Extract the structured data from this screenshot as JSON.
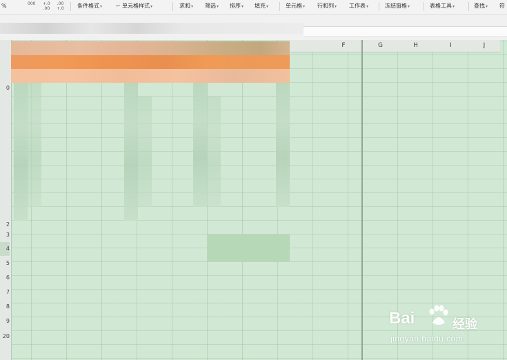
{
  "toolbar": {
    "percent": "%",
    "thousands": "000",
    "dec_inc_top": "+.0",
    "dec_inc_bottom": ".00",
    "dec_dec_top": ".00",
    "dec_dec_bottom": "+.0",
    "conditional_format": "条件格式",
    "cell_style": "单元格样式",
    "sum": "求和",
    "filter": "筛选",
    "sort": "排序",
    "fill": "填充",
    "cell": "单元格",
    "row_col": "行和列",
    "worksheet": "工作表",
    "freeze": "冻结窗格",
    "table_tools": "表格工具",
    "find": "查找",
    "symbol": "符"
  },
  "columns": [
    "F",
    "G",
    "H",
    "I",
    "J"
  ],
  "rows": [
    "0",
    "2",
    "3",
    "4",
    "5",
    "6",
    "7",
    "8",
    "9",
    "20"
  ],
  "active_row": "4",
  "watermark": {
    "logo": "Bai",
    "chinese": "经验",
    "url": "jingyan.baidu.com"
  },
  "colors": {
    "sheet_background": "#d0e8d4",
    "header_orange": "#ef9655",
    "header_peach": "#f4c19d",
    "header_tan": "#e3b496"
  }
}
